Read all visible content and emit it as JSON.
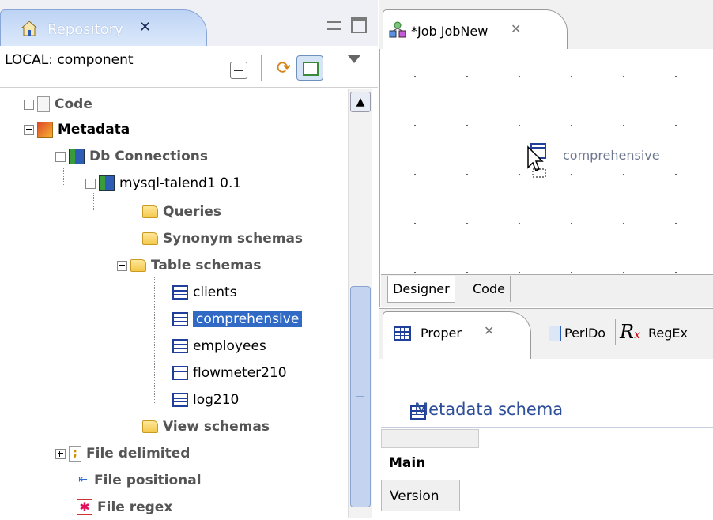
{
  "repository": {
    "tab_label": "Repository",
    "filter_label": "LOCAL: component",
    "tree": [
      {
        "label": "Code"
      },
      {
        "label": "Metadata"
      },
      {
        "label": "Db Connections"
      },
      {
        "label": "mysql-talend1 0.1"
      },
      {
        "label": "Queries"
      },
      {
        "label": "Synonym schemas"
      },
      {
        "label": "Table schemas"
      },
      {
        "label": "clients"
      },
      {
        "label": "comprehensive"
      },
      {
        "label": "employees"
      },
      {
        "label": "flowmeter210"
      },
      {
        "label": "log210"
      },
      {
        "label": "View schemas"
      },
      {
        "label": "File delimited"
      },
      {
        "label": "File positional"
      },
      {
        "label": "File regex"
      }
    ]
  },
  "job": {
    "tab_title": "*Job JobNew",
    "drag_label": "comprehensive",
    "bottom_tabs": [
      "Designer",
      "Code"
    ]
  },
  "properties": {
    "tabs": [
      "Proper",
      "PerlDo",
      "RegEx"
    ],
    "section_title": "Metadata schema",
    "rows": [
      "Main",
      "Version"
    ]
  },
  "colors": {
    "selection": "#316ac5",
    "section_title": "#2e4e9a"
  }
}
